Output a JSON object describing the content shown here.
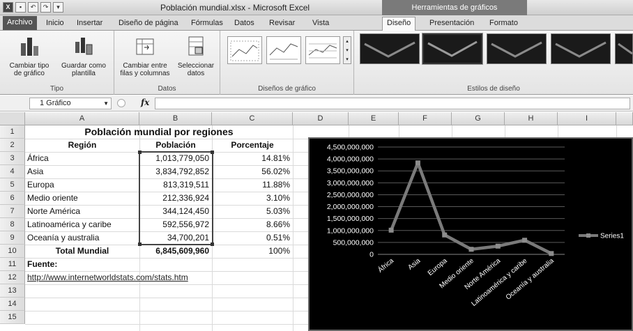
{
  "window": {
    "title": "Población mundial.xlsx  -  Microsoft Excel",
    "context_tools": "Herramientas de gráficos"
  },
  "tabs": [
    "Archivo",
    "Inicio",
    "Insertar",
    "Diseño de página",
    "Fórmulas",
    "Datos",
    "Revisar",
    "Vista",
    "Diseño",
    "Presentación",
    "Formato"
  ],
  "active_tab": "Diseño",
  "ribbon": {
    "tipo": {
      "label": "Tipo",
      "btn1": "Cambiar tipo de gráfico",
      "btn1_l1": "Cambiar tipo",
      "btn1_l2": "de gráfico",
      "btn2_l1": "Guardar como",
      "btn2_l2": "plantilla"
    },
    "datos": {
      "label": "Datos",
      "btn1_l1": "Cambiar entre",
      "btn1_l2": "filas y columnas",
      "btn2_l1": "Seleccionar",
      "btn2_l2": "datos"
    },
    "disenos": {
      "label": "Diseños de gráfico"
    },
    "estilos": {
      "label": "Estilos de diseño"
    }
  },
  "formula_bar": {
    "name_box": "1 Gráfico",
    "fx": "fx",
    "formula": ""
  },
  "columns": [
    "A",
    "B",
    "C",
    "D",
    "E",
    "F",
    "G",
    "H",
    "I"
  ],
  "rows": [
    "1",
    "2",
    "3",
    "4",
    "5",
    "6",
    "7",
    "8",
    "9",
    "10",
    "11",
    "12",
    "13",
    "14",
    "15"
  ],
  "sheet": {
    "title": "Población mundial por regiones",
    "headers": {
      "region": "Región",
      "poblacion": "Población",
      "porcentaje": "Porcentaje"
    },
    "data": [
      {
        "region": "África",
        "poblacion": "1,013,779,050",
        "porcentaje": "14.81%"
      },
      {
        "region": "Asia",
        "poblacion": "3,834,792,852",
        "porcentaje": "56.02%"
      },
      {
        "region": "Europa",
        "poblacion": "813,319,511",
        "porcentaje": "11.88%"
      },
      {
        "region": "Medio oriente",
        "poblacion": "212,336,924",
        "porcentaje": "3.10%"
      },
      {
        "region": "Norte América",
        "poblacion": "344,124,450",
        "porcentaje": "5.03%"
      },
      {
        "region": "Latinoamérica y caribe",
        "poblacion": "592,556,972",
        "porcentaje": "8.66%"
      },
      {
        "region": "Oceanía y australia",
        "poblacion": "34,700,201",
        "porcentaje": "0.51%"
      }
    ],
    "total": {
      "label": "Total Mundial",
      "poblacion": "6,845,609,960",
      "porcentaje": "100%"
    },
    "fuente_label": "Fuente:",
    "fuente_url": "http://www.internetworldstats.com/stats.htm"
  },
  "chart_data": {
    "type": "line",
    "categories": [
      "África",
      "Asia",
      "Europa",
      "Medio oriente",
      "Norte América",
      "Latinoamérica y caribe",
      "Oceanía y australia"
    ],
    "series": [
      {
        "name": "Series1",
        "values": [
          1013779050,
          3834792852,
          813319511,
          212336924,
          344124450,
          592556972,
          34700201
        ]
      }
    ],
    "ylim": [
      0,
      4500000000
    ],
    "yticks": [
      "0",
      "500,000,000",
      "1,000,000,000",
      "1,500,000,000",
      "2,000,000,000",
      "2,500,000,000",
      "3,000,000,000",
      "3,500,000,000",
      "4,000,000,000",
      "4,500,000,000"
    ],
    "grid": true,
    "legend": "right",
    "colors": {
      "background": "#000000",
      "line": "#7a7a7a",
      "grid": "#5a5a5a",
      "text": "#ffffff"
    }
  }
}
